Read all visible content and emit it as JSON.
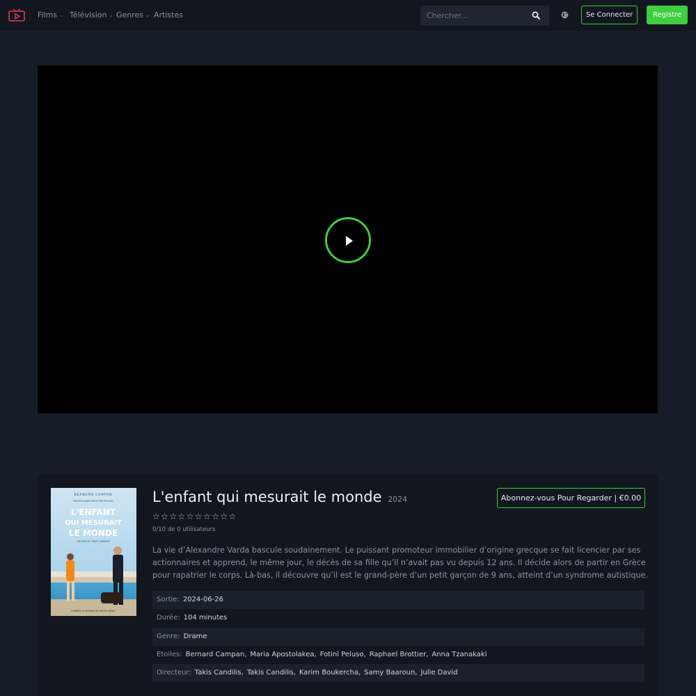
{
  "nav": {
    "items": [
      {
        "label": "Films",
        "has_dropdown": true
      },
      {
        "label": "Télévision",
        "has_dropdown": true
      },
      {
        "label": "Genres",
        "has_dropdown": true
      },
      {
        "label": "Artistes",
        "has_dropdown": false
      }
    ],
    "search_placeholder": "Chercher...",
    "login_label": "Se Connecter",
    "register_label": "Registre"
  },
  "icons": {
    "logo": "tv-play-logo-icon",
    "search": "search-icon",
    "language": "globe-icon",
    "play": "play-icon",
    "star": "star-outline-icon"
  },
  "colors": {
    "accent": "#3fce3f",
    "logo": "#e0365f",
    "background": "#171d26",
    "panel": "#12161e"
  },
  "movie": {
    "title": "L'enfant qui mesurait le monde",
    "year": "2024",
    "stars_total": 10,
    "stars_filled": 0,
    "rating_text": "0/10 de 0 utilisateurs",
    "subscribe_label": "Abonnez-vous Pour Regarder | €0.00",
    "synopsis": "La vie d’Alexandre Varda bascule soudainement. Le puissant promoteur immobilier d’origine grecque se fait licencier par ses actionnaires et apprend, le même jour, le décès de sa fille qu’il n’avait pas vu depuis 12 ans. Il décide alors de partir en Grèce pour rapatrier le corps. Là-bas, il découvre qu’il est le grand-père d’un petit garçon de 9 ans, atteint d’un syndrome autistique.",
    "poster": {
      "top_name": "BERNARD CAMPAN",
      "cast_line": "APOSTOLAKEA   BROTTIER   PELUSO",
      "title_lines": [
        "L'ENFANT",
        "QUI MESURAIT",
        "LE MONDE"
      ],
      "director_line": "UN FILM DE TAKIS CANDILIS",
      "bottom_line": "D'APRÈS LE ROMAN DE METIN ARDITI"
    },
    "details": [
      {
        "label": "Sortie:",
        "values": [
          "2024-06-26"
        ]
      },
      {
        "label": "Durée:",
        "values": [
          "104 minutes"
        ]
      },
      {
        "label": "Genre:",
        "values": [
          "Drame"
        ]
      },
      {
        "label": "Etoiles:",
        "values": [
          "Bernard Campan",
          "Maria Apostolakea",
          "Fotinì Peluso",
          "Raphael Brottier",
          "Anna Tzanakaki"
        ]
      },
      {
        "label": "Directeur:",
        "values": [
          "Takis Candilis",
          "Takis Candilis",
          "Karim Boukercha",
          "Samy Baaroun",
          "Julie David"
        ]
      }
    ]
  }
}
